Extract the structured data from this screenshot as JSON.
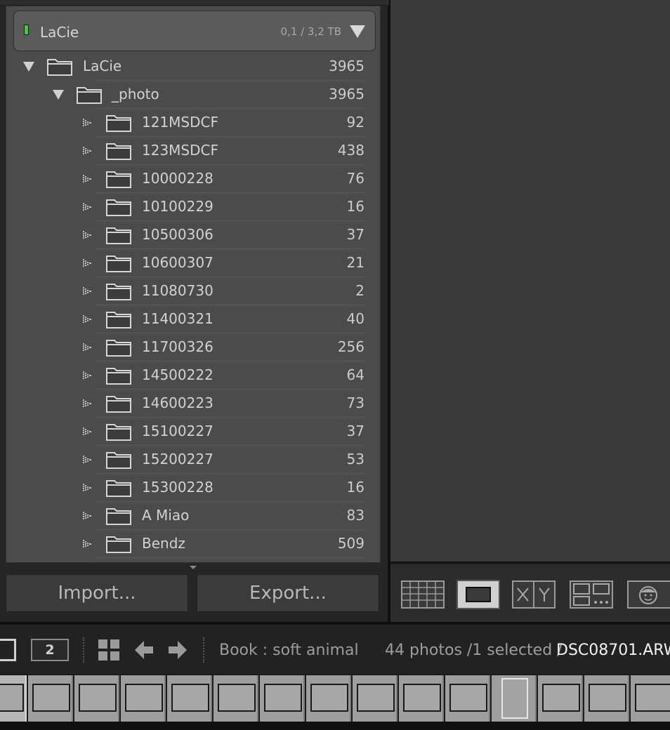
{
  "volume": {
    "name": "LaCie",
    "capacity": "0,1 / 3,2 TB",
    "indicator_color": "#3ecc3e"
  },
  "tree": {
    "root": {
      "label": "LaCie",
      "count": "3965"
    },
    "photo": {
      "label": "_photo",
      "count": "3965"
    },
    "folders": [
      {
        "label": "121MSDCF",
        "count": "92"
      },
      {
        "label": "123MSDCF",
        "count": "438"
      },
      {
        "label": "10000228",
        "count": "76"
      },
      {
        "label": "10100229",
        "count": "16"
      },
      {
        "label": "10500306",
        "count": "37"
      },
      {
        "label": "10600307",
        "count": "21"
      },
      {
        "label": "11080730",
        "count": "2"
      },
      {
        "label": "11400321",
        "count": "40"
      },
      {
        "label": "11700326",
        "count": "256"
      },
      {
        "label": "14500222",
        "count": "64"
      },
      {
        "label": "14600223",
        "count": "73"
      },
      {
        "label": "15100227",
        "count": "37"
      },
      {
        "label": "15200227",
        "count": "53"
      },
      {
        "label": "15300228",
        "count": "16"
      },
      {
        "label": "A Miao",
        "count": "83"
      },
      {
        "label": "Bendz",
        "count": "509"
      }
    ]
  },
  "buttons": {
    "import": "Import...",
    "export": "Export..."
  },
  "toolbar": {
    "icons": [
      "grid-view-icon",
      "loupe-view-icon",
      "compare-view-icon",
      "survey-view-icon",
      "people-view-icon"
    ]
  },
  "filmstrip_bar": {
    "second_window": "2",
    "source": "Book : soft animal",
    "count": "44 photos /1 selected /",
    "file": "DSC08701.ARW"
  },
  "filmstrip": {
    "thumbnail_count": 15,
    "selected_index": 11
  }
}
